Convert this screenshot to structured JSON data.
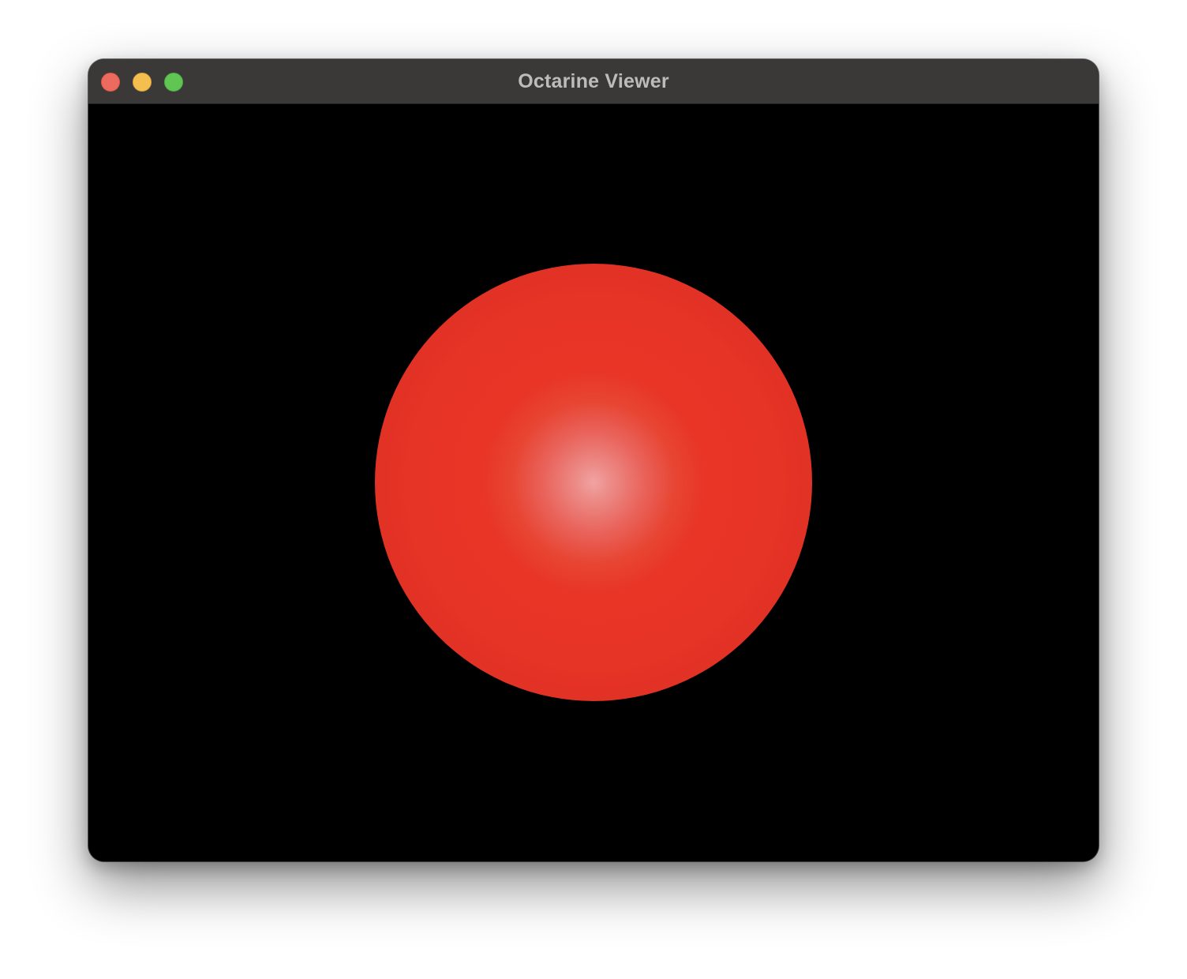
{
  "window": {
    "title": "Octarine Viewer",
    "controls": {
      "close": "close-button",
      "minimize": "minimize-button",
      "zoom": "zoom-button"
    }
  },
  "viewport": {
    "background_color": "#000000",
    "object": {
      "shape": "sphere",
      "color": "#e83526",
      "highlight_color": "#f1a3a3"
    }
  }
}
